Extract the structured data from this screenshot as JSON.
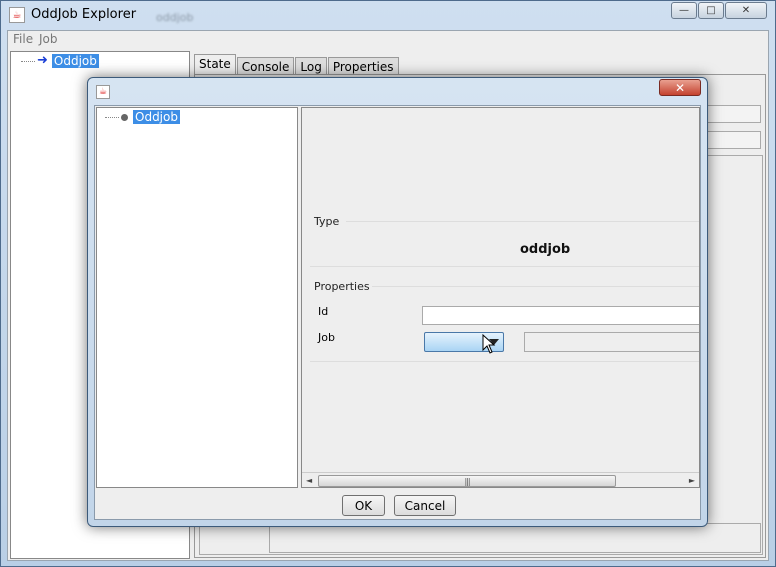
{
  "main_window": {
    "title": "OddJob Explorer",
    "title_blurred": "oddjob",
    "controls": {
      "minimize": "—",
      "maximize": "□",
      "close": "✕"
    }
  },
  "menu": {
    "items": [
      "File",
      "Job"
    ]
  },
  "tree": {
    "root_label": "Oddjob"
  },
  "tabs": [
    "State",
    "Console",
    "Log",
    "Properties"
  ],
  "active_tab": "State",
  "dialog": {
    "close_label": "✕",
    "tree_root_label": "Oddjob",
    "type_section": "Type",
    "type_value": "oddjob",
    "properties_section": "Properties",
    "id_label": "Id",
    "job_label": "Job",
    "scroll_left": "◄",
    "scroll_right": "►",
    "scroll_grip": "|||",
    "ok_label": "OK",
    "cancel_label": "Cancel"
  }
}
